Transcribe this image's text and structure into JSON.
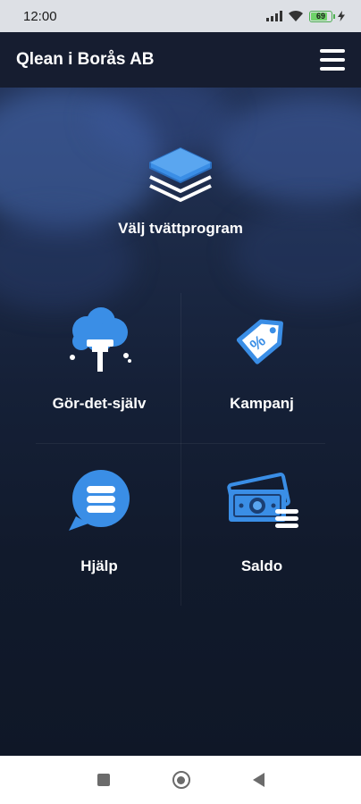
{
  "status_bar": {
    "time": "12:00",
    "battery_level": "69",
    "icons": [
      "signal-icon",
      "wifi-icon",
      "battery-icon",
      "charging-icon"
    ]
  },
  "header": {
    "title": "Qlean i Borås AB",
    "menu_icon": "hamburger-menu-icon"
  },
  "main": {
    "program": {
      "label": "Välj tvättprogram",
      "icon": "layers-stack-icon"
    },
    "tiles": [
      {
        "label": "Gör-det-själv",
        "icon": "foam-brush-icon"
      },
      {
        "label": "Kampanj",
        "icon": "discount-tag-icon"
      },
      {
        "label": "Hjälp",
        "icon": "chat-bubble-icon"
      },
      {
        "label": "Saldo",
        "icon": "banknotes-icon"
      }
    ]
  },
  "colors": {
    "header_bg": "#161d30",
    "accent_blue": "#3a8ee6",
    "text": "#ffffff",
    "nav_bg": "#ffffff"
  },
  "nav_bar": {
    "buttons": [
      "recent-apps-icon",
      "home-icon",
      "back-icon"
    ]
  }
}
